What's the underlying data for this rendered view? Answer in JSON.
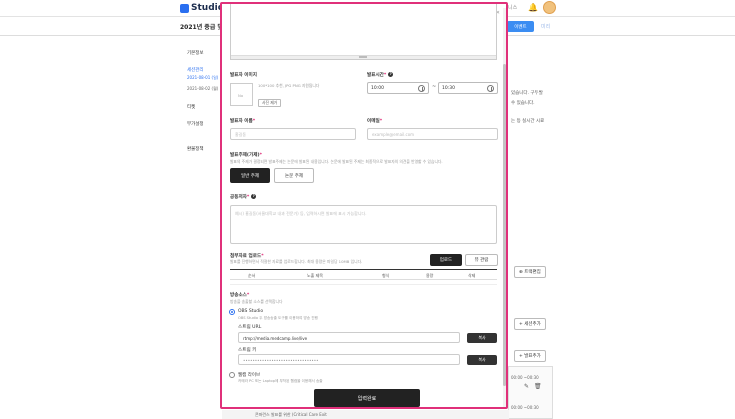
{
  "header": {
    "app_name": "Studio",
    "right_text": "니스",
    "brand_color": "#2a6ff0"
  },
  "subheader": {
    "event_title": "2021년 중급 및",
    "blue_button": "이벤트",
    "link": "미리"
  },
  "sidebar": {
    "items": [
      {
        "label": "기본정보"
      },
      {
        "label": "세션관리"
      },
      {
        "label": "2021-08-01 (일)"
      },
      {
        "label": "2021-08-02 (월)"
      },
      {
        "label": "티켓"
      },
      {
        "label": "부가설정"
      },
      {
        "label": "환불정책"
      }
    ]
  },
  "background": {
    "right_text_1": "있습니다. 구두발",
    "right_text_2": "수 있습니다.",
    "right_text_3": "는 등 실시간 시료",
    "btn_1": "⊕ 트랙편집",
    "btn_2": "+ 세션추가",
    "btn_3": "+ 발표추가",
    "time_1": "00:00 ~00:30",
    "time_2": "00:00 ~00:30",
    "bottom_text": "콘퍼런스 발표를 위한 (Critical Care Exit"
  },
  "modal": {
    "close_icon": "close-icon",
    "photo": {
      "label": "발표자 이미지",
      "box_text": "No",
      "hint": "100*100 추천, JPG PNG 지원됩니다",
      "delete_button": "사진 제거"
    },
    "time": {
      "label": "발표시간",
      "start": "10:00",
      "separator": "~",
      "end": "10:30"
    },
    "name": {
      "label": "발표자 이름",
      "placeholder": "홍길동"
    },
    "email": {
      "label": "이메일",
      "placeholder": "example@email.com"
    },
    "topic": {
      "label": "발표주제(가제)",
      "hint": "발표의 주제가 결정되면 발표주제는 논문에 발표된 내용입니다. 논문에 발표된 주제는 최종적으로 발표자의 의견을 반영할 수 있습니다.",
      "option_general": "일반 주제",
      "option_paper": "논문 주제"
    },
    "notice": {
      "label": "공동저자",
      "placeholder": "예시) 홍길동(서울대학교 내과 전문가) 등, 입력하시면 발표에 표시 가능합니다."
    },
    "file": {
      "label": "첨부자료 업로드",
      "hint": "발표를 진행하면서 적절한 자료를 업로드합니다. 최대 용량은 파일당 10MB 입니다.",
      "upload_button": "업로드",
      "view_button": "뷰 관람",
      "columns": [
        "순서",
        "노출 제목",
        "형식",
        "용량",
        "삭제"
      ]
    },
    "broadcast": {
      "label": "방송소스",
      "hint": "방송을 송출할 소스를 선택합니다",
      "obs_label": "OBS Studio",
      "obs_desc": "OBS Studio 두 방송송출 도구를 이용하여 방송 진행",
      "url_label": "스트림 URL",
      "url_value": "rtmp://media.medcamp.live/live",
      "key_label": "스트림 키",
      "key_value": "••••••••••••••••••••••••••••••••",
      "copy_button": "복사",
      "zoom_label": "웹캠 라이브",
      "zoom_desc": "카메라 PC 또는 Laptop에 부착된 웹캠을 이용해서 송출"
    },
    "submit_button": "입력완료"
  }
}
